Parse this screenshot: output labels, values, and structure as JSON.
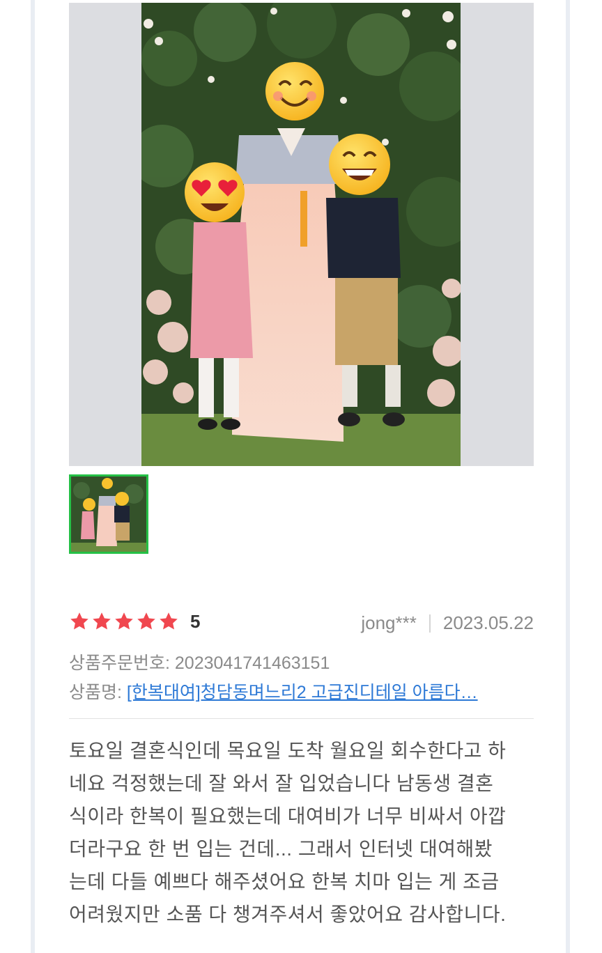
{
  "review": {
    "rating_score": "5",
    "stars_filled": 5,
    "stars_total": 5,
    "author": "jong***",
    "date": "2023.05.22",
    "order_label": "상품주문번호:",
    "order_number": "2023041741463151",
    "product_label": "상품명:",
    "product_name": "[한복대여]청담동며느리2 고급진디테일 아름다…",
    "text": "토요일 결혼식인데 목요일 도착 월요일 회수한다고 하\n네요 걱정했는데 잘 와서 잘 입었습니다 남동생 결혼\n식이라 한복이 필요했는데 대여비가 너무 비싸서 아깝\n더라구요 한 번 입는 건데... 그래서 인터넷 대여해봤\n는데 다들 예쁘다 해주셨어요 한복 치마 입는 게 조금\n어려웠지만 소품 다 챙겨주셔서 좋았어요 감사합니다."
  },
  "colors": {
    "star": "#f0474f",
    "thumb_border": "#25c046",
    "link": "#2d79d6"
  },
  "icons": {
    "star": "star-icon",
    "emoji_smile": "smiling-face-emoji",
    "emoji_hearts": "heart-eyes-emoji",
    "emoji_grin": "grinning-face-emoji"
  }
}
